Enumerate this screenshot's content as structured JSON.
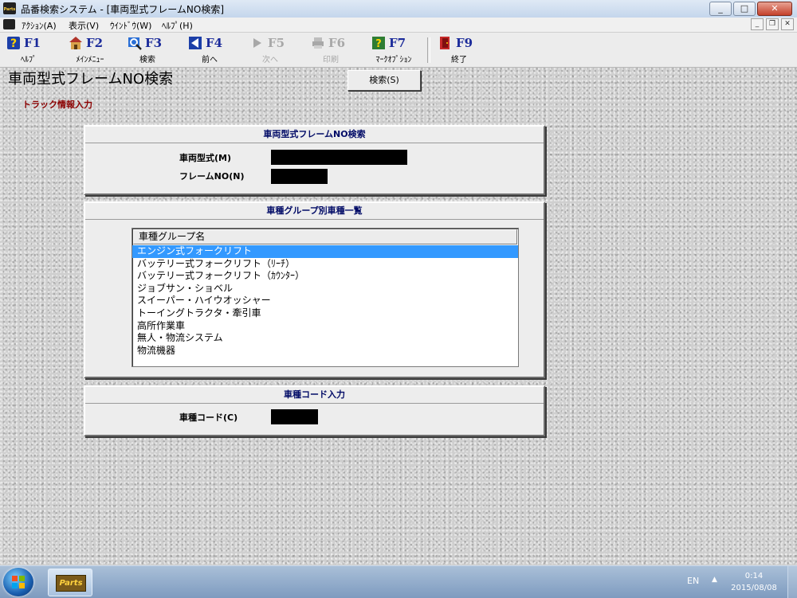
{
  "window": {
    "icon_text": "Parts",
    "title": "品番検索システム - [車両型式フレームNO検索]",
    "controls": {
      "minimize": "_",
      "maximize": "□",
      "close": "✕"
    }
  },
  "menu": {
    "items": [
      "ｱｸｼｮﾝ(A)",
      "表示(V)",
      "ｳｲﾝﾄﾞｳ(W)",
      "ﾍﾙﾌﾟ(H)"
    ],
    "mdi_controls": {
      "minimize": "_",
      "restore": "❐",
      "close": "✕"
    }
  },
  "toolbar": {
    "keys": [
      {
        "code": "F1",
        "label": "ﾍﾙﾌﾟ",
        "icon": "help-icon"
      },
      {
        "code": "F2",
        "label": "ﾒｲﾝﾒﾆｭｰ",
        "icon": "main-menu-icon"
      },
      {
        "code": "F3",
        "label": "検索",
        "icon": "search-icon"
      },
      {
        "code": "F4",
        "label": "前へ",
        "icon": "back-icon"
      },
      {
        "code": "F5",
        "label": "次へ",
        "icon": "next-icon",
        "disabled": true
      },
      {
        "code": "F6",
        "label": "印刷",
        "icon": "print-icon",
        "disabled": true
      },
      {
        "code": "F7",
        "label": "ﾏｰｸｵﾌﾟｼｮﾝ",
        "icon": "mark-option-icon"
      },
      {
        "code": "F9",
        "label": "終了",
        "icon": "exit-icon"
      }
    ]
  },
  "page": {
    "title": "車両型式フレームNO検索",
    "search_button": "検索(S)",
    "section_label": "トラック情報入力"
  },
  "frame_search": {
    "heading": "車両型式フレームNO検索",
    "model_label": "車両型式(M)",
    "frame_label": "フレームNO(N)"
  },
  "group_list": {
    "heading": "車種グループ別車種一覧",
    "column_header": "車種グループ名",
    "items": [
      "エンジン式フォークリフト",
      "バッテリー式フォークリフト（ﾘｰﾁ）",
      "バッテリー式フォークリフト（ｶｳﾝﾀｰ）",
      "ジョブサン・ショベル",
      "スイーパー・ハイウオッシャー",
      "トーイングトラクタ・牽引車",
      "高所作業車",
      "無人・物流システム",
      "物流機器"
    ],
    "selected_index": 0
  },
  "code_input": {
    "heading": "車種コード入力",
    "code_label": "車種コード(C)"
  },
  "taskbar": {
    "app_label": "Parts",
    "language": "EN",
    "tray_arrow": "▲",
    "time": "0:14",
    "date": "2015/08/08"
  },
  "colors": {
    "toolbar_key_text": "#1a2a9a",
    "section_label": "#8b0000",
    "panel_heading": "#000a66",
    "selection": "#3399ff"
  }
}
